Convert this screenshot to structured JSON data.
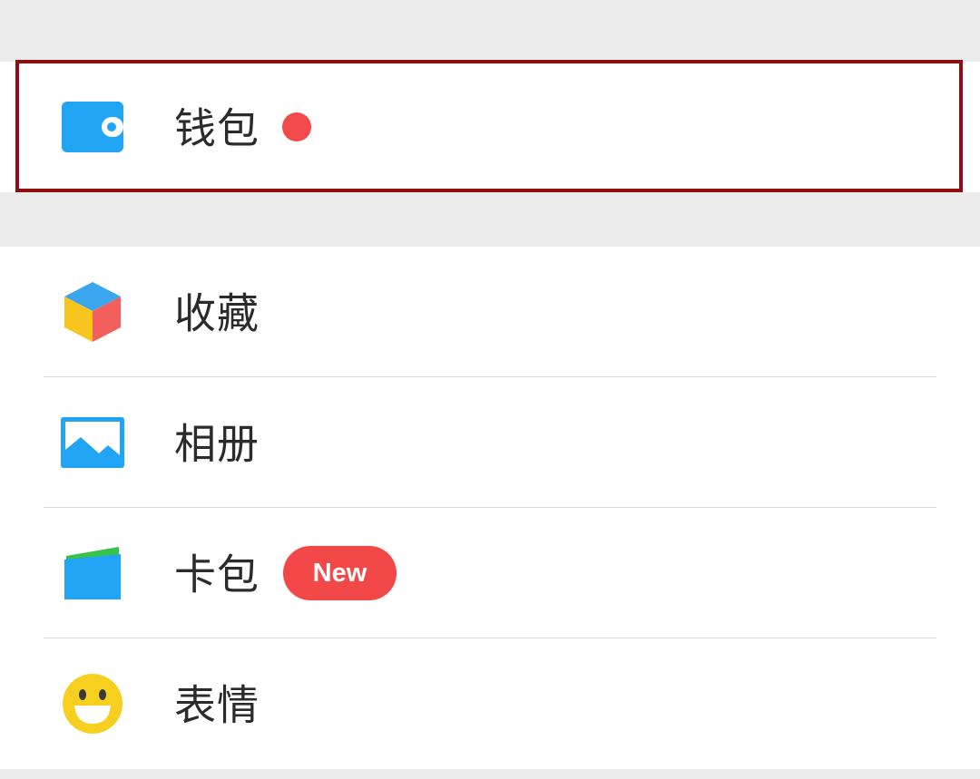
{
  "wallet": {
    "label": "钱包",
    "icon": "wallet-icon",
    "has_red_dot": true,
    "icon_color": "#22a4f5"
  },
  "menu": {
    "items": [
      {
        "label": "收藏",
        "icon": "favorites-cube-icon"
      },
      {
        "label": "相册",
        "icon": "photo-album-icon"
      },
      {
        "label": "卡包",
        "icon": "card-wallet-icon",
        "badge": "New"
      },
      {
        "label": "表情",
        "icon": "smiley-face-icon"
      }
    ]
  },
  "colors": {
    "background": "#ebebeb",
    "card": "#ffffff",
    "badge_red": "#f24848",
    "highlight_border": "#8e0f0f",
    "accent_blue": "#22a4f5"
  }
}
